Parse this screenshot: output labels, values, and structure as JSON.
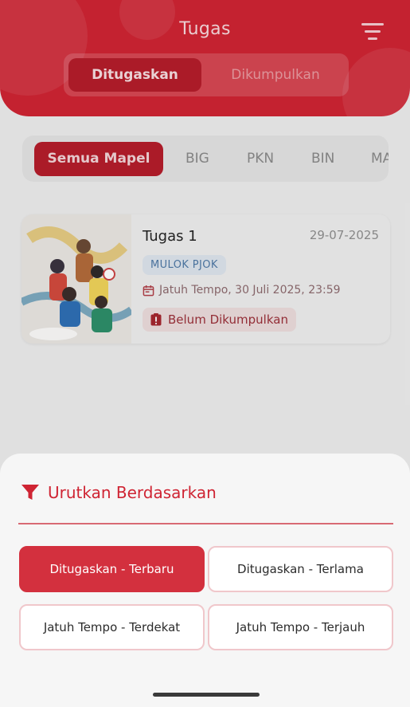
{
  "header": {
    "title": "Tugas",
    "segments": [
      "Ditugaskan",
      "Dikumpulkan"
    ],
    "active_segment": "Ditugaskan"
  },
  "icons": {
    "filter": "filter-lines-icon",
    "calendar": "calendar-icon",
    "alert": "alert-clipboard-icon",
    "funnel": "funnel-icon"
  },
  "subjects": {
    "active": "Semua Mapel",
    "items": [
      "BIG",
      "PKN",
      "BIN",
      "MA"
    ]
  },
  "assignment": {
    "title": "Tugas 1",
    "date": "29-07-2025",
    "tag": "MULOK PJOK",
    "due": "Jatuh Tempo, 30 Juli 2025, 23:59",
    "status": "Belum Dikumpulkan"
  },
  "sort_sheet": {
    "title": "Urutkan Berdasarkan",
    "options": [
      "Ditugaskan - Terbaru",
      "Ditugaskan - Terlama",
      "Jatuh Tempo - Terdekat",
      "Jatuh Tempo - Terjauh"
    ],
    "selected": "Ditugaskan - Terbaru"
  },
  "colors": {
    "primary": "#cf2433",
    "primary_dark": "#b51d2b",
    "tag_text": "#4f79a6"
  }
}
